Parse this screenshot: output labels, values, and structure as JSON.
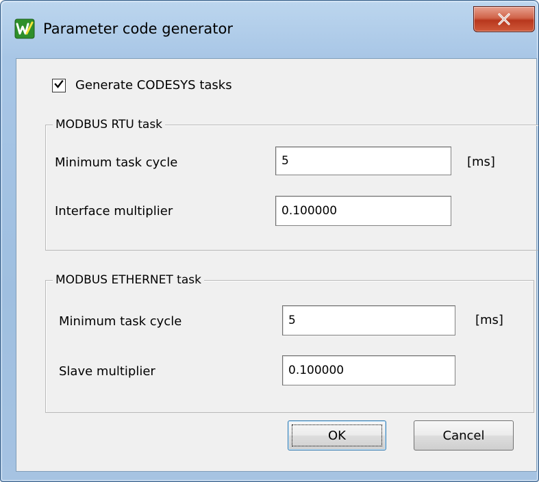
{
  "window": {
    "title": "Parameter code generator",
    "close_glyph": "✕"
  },
  "options": {
    "generate_codesys_tasks_label": "Generate CODESYS tasks",
    "generate_codesys_tasks_checked": true
  },
  "modbus_rtu": {
    "legend": "MODBUS RTU task",
    "min_cycle_label": "Minimum task cycle",
    "min_cycle_value": "5",
    "min_cycle_unit": "[ms]",
    "multiplier_label": "Interface multiplier",
    "multiplier_value": "0.100000"
  },
  "modbus_ethernet": {
    "legend": "MODBUS ETHERNET task",
    "min_cycle_label": "Minimum task cycle",
    "min_cycle_value": "5",
    "min_cycle_unit": "[ms]",
    "multiplier_label": "Slave multiplier",
    "multiplier_value": "0.100000"
  },
  "buttons": {
    "ok_label": "OK",
    "cancel_label": "Cancel"
  },
  "colors": {
    "frame": "#a6c3e2",
    "client_background": "#f0f0f0",
    "close_button": "#c8452b",
    "app_icon": "#3aa232"
  },
  "icons": {
    "app": "app-icon",
    "close": "close-icon",
    "check": "check-icon"
  }
}
